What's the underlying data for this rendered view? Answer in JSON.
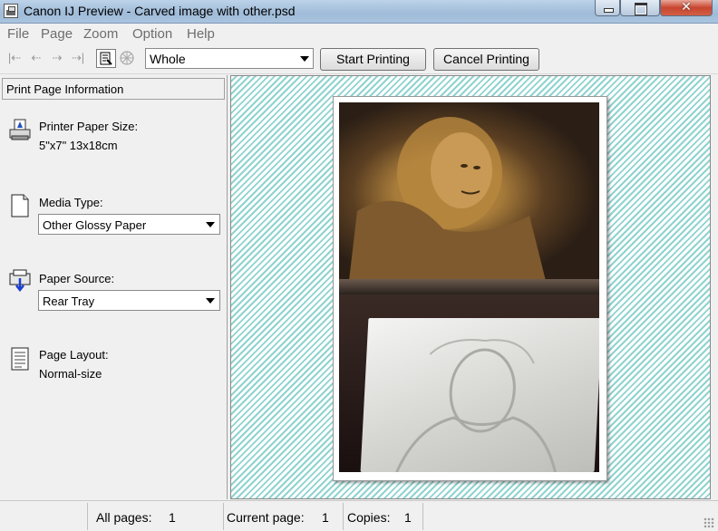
{
  "window": {
    "title": "Canon IJ Preview - Carved image with other.psd",
    "close_symbol": "✕"
  },
  "menu": {
    "items": [
      "File",
      "Page",
      "Zoom",
      "Option",
      "Help"
    ]
  },
  "toolbar": {
    "icons": [
      "first-page-icon",
      "previous-page-icon",
      "next-page-icon",
      "last-page-icon",
      "page-info-icon",
      "color-adjust-icon"
    ],
    "zoom_value": "Whole",
    "start_printing_label": "Start Printing",
    "cancel_printing_label": "Cancel Printing"
  },
  "panel": {
    "header": "Print Page Information",
    "paper_size_label": "Printer Paper Size:",
    "paper_size_value": "5\"x7\" 13x18cm",
    "media_type_label": "Media Type:",
    "media_type_value": "Other Glossy Paper",
    "paper_source_label": "Paper Source:",
    "paper_source_value": "Rear Tray",
    "page_layout_label": "Page Layout:",
    "page_layout_value": "Normal-size"
  },
  "status": {
    "all_pages_label": "All pages:",
    "all_pages_value": "1",
    "current_page_label": "Current page:",
    "current_page_value": "1",
    "copies_label": "Copies:",
    "copies_value": "1"
  },
  "colors": {
    "preview_stripe": "#8fd3d0",
    "titlebar": "#bcd3ea",
    "close_button": "#c8452f"
  }
}
